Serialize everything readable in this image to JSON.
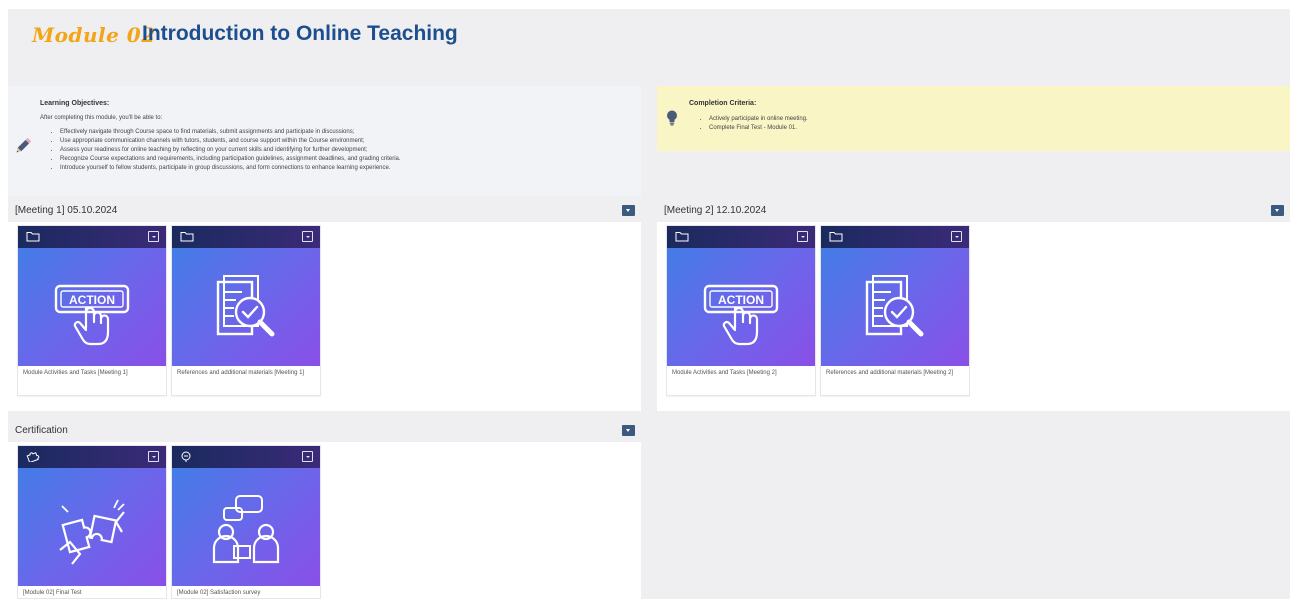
{
  "header": {
    "module_tag": "Module 02",
    "title": "Introduction to Online Teaching"
  },
  "objectives": {
    "icon": "pencil-icon",
    "title": "Learning Objectives:",
    "intro": "After completing this module, you'll be able to:",
    "items": [
      "Effectively navigate through Course space to find materials, submit assignments and participate in discussions;",
      "Use appropriate communication channels with tutors, students, and course support within the Course environment;",
      "Assess your readiness for online teaching by reflecting on your current skills and identifying for further development;",
      "Recognize Course expectations and requirements, including participation guidelines, assignment deadlines, and grading criteria.",
      "Introduce yourself to fellow students, participate in group discussions, and form connections to enhance learning experience."
    ]
  },
  "criteria": {
    "icon": "lightbulb-icon",
    "title": "Completion Criteria:",
    "items": [
      "Actively participate in online meeting.",
      "Complete Final Test - Module 01."
    ]
  },
  "sections": [
    {
      "title": "[Meeting 1] 05.10.2024",
      "cards": [
        {
          "type_icon": "folder-icon",
          "illustration": "action-button-icon",
          "label": "Module Activities and Tasks [Meeting 1]"
        },
        {
          "type_icon": "folder-icon",
          "illustration": "document-magnifier-icon",
          "label": "References and additional materials [Meeting 1]"
        }
      ]
    },
    {
      "title": "[Meeting 2] 12.10.2024",
      "cards": [
        {
          "type_icon": "folder-icon",
          "illustration": "action-button-icon",
          "label": "Module Activities and Tasks [Meeting 2]"
        },
        {
          "type_icon": "folder-icon",
          "illustration": "document-magnifier-icon",
          "label": "References and additional materials [Meeting 2]"
        }
      ]
    },
    {
      "title": "Certification",
      "cards": [
        {
          "type_icon": "puzzle-icon",
          "illustration": "puzzle-hands-icon",
          "label": "[Module 02] Final Test"
        },
        {
          "type_icon": "feedback-icon",
          "illustration": "discussion-people-icon",
          "label": "[Module 02] Satisfaction survey"
        }
      ]
    }
  ],
  "illustration_text": {
    "action": "ACTION"
  },
  "colors": {
    "module_tag": "#f2a516",
    "title": "#1d4f8f",
    "card_gradient_start": "#3d80e6",
    "card_gradient_end": "#8a4fe8",
    "criteria_bg": "#faf5c5",
    "collapse_button": "#3c5a7f"
  }
}
